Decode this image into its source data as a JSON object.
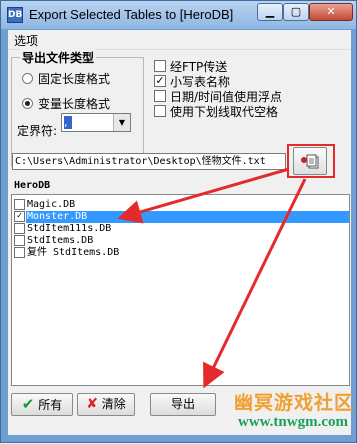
{
  "window": {
    "title": "Export Selected Tables to [HeroDB]",
    "icon_label": "DB",
    "minimize_icon": "minimize-icon",
    "maximize_icon": "maximize-icon",
    "close_icon": "close-icon"
  },
  "menu": {
    "options": "选项"
  },
  "export_type": {
    "title": "导出文件类型",
    "fixed_label": "固定长度格式",
    "variable_label": "变量长度格式",
    "selected": "variable",
    "delimiter_label": "定界符:",
    "delimiter_value": ","
  },
  "options": {
    "ftp_label": "经FTP传送",
    "ftp_checked": false,
    "lowercase_label": "小写表名称",
    "lowercase_checked": true,
    "datetime_float_label": "日期/时间值使用浮点",
    "datetime_float_checked": false,
    "underscore_label": "使用下划线取代空格",
    "underscore_checked": false
  },
  "path": {
    "value": "C:\\Users\\Administrator\\Desktop\\怪物文件.txt",
    "browse_icon": "folder-browse-icon"
  },
  "database": {
    "name": "HeroDB",
    "tables": [
      {
        "name": "Magic.DB",
        "checked": false,
        "selected": false
      },
      {
        "name": "Monster.DB",
        "checked": true,
        "selected": true
      },
      {
        "name": "StdItem111s.DB",
        "checked": false,
        "selected": false
      },
      {
        "name": "StdItems.DB",
        "checked": false,
        "selected": false
      },
      {
        "name": "复件 StdItems.DB",
        "checked": false,
        "selected": false
      }
    ]
  },
  "buttons": {
    "all_label": "所有",
    "clear_label": "清除",
    "export_label": "导出",
    "all_icon": "green-check-icon",
    "clear_icon": "red-x-icon"
  },
  "watermark": {
    "top": "幽冥游戏社区",
    "bottom": "www.tnwgm.com"
  },
  "colors": {
    "selection": "#3399ff",
    "annotation_red": "#e32b2b",
    "watermark_orange": "#f0a030",
    "watermark_green": "#18a05a"
  }
}
